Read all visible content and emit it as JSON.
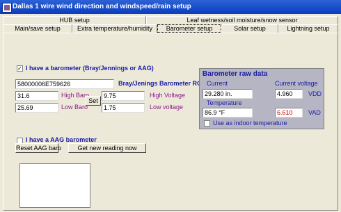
{
  "window": {
    "title": "Dallas 1 wire wind direction and windspeed/rain setup"
  },
  "tabs_row1": [
    {
      "label": "HUB setup"
    },
    {
      "label": "Leaf wetness/soil moisture/snow sensor"
    }
  ],
  "tabs_row2": [
    {
      "label": "Main/save setup"
    },
    {
      "label": "Extra temperature/humidity"
    },
    {
      "label": "Barometer setup"
    },
    {
      "label": "Solar setup"
    },
    {
      "label": "Lightning setup"
    }
  ],
  "barometer": {
    "have_label": "I have a barometer (Bray/Jennings or AAG)",
    "have_checked": true,
    "rom_id": "58000006E759626",
    "rom_id_label": "Bray/Jenings Barometer ROM ID",
    "high_baro": "31.6",
    "high_baro_label": "High Baro",
    "low_baro": "25.69",
    "low_baro_label": "Low Baro",
    "set_label": "Set",
    "high_voltage": "9.75",
    "high_voltage_label": "High Voltage",
    "low_voltage": "1.75",
    "low_voltage_label": "Low voltage"
  },
  "raw": {
    "title": "Barometer raw data",
    "current_label": "Current",
    "current_value": "29.280 in.",
    "current_voltage_label": "Current voltage",
    "voltage_value": "4.960",
    "vdd_label": "VDD",
    "temperature_label": "Temperature",
    "temperature_value": "86.9 °F",
    "vad_value": "6.610",
    "vad_label": "VAD",
    "indoor_label": "Use as indoor temperature",
    "indoor_checked": false,
    "vad_color": "#c00000"
  },
  "aag": {
    "label": "I have a AAG barometer",
    "checked": false,
    "reset_label": "Reset AAG baro",
    "new_reading_label": "Get new reading now"
  }
}
